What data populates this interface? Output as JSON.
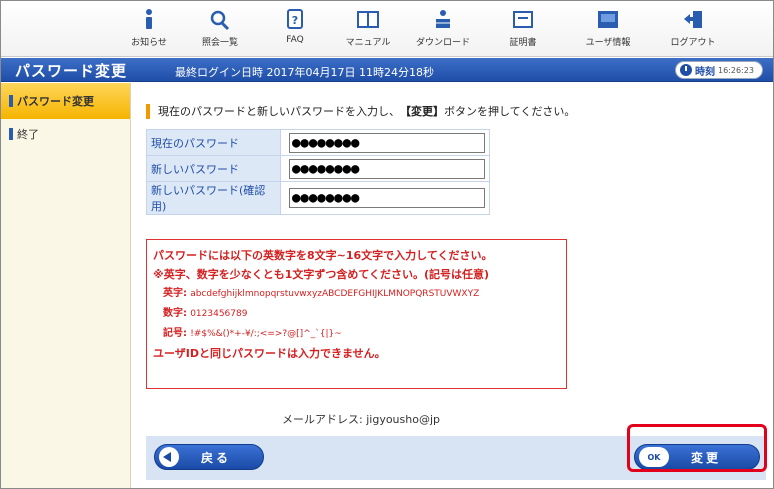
{
  "toolbar": {
    "items": [
      {
        "label": "お知らせ",
        "icon": "info-icon"
      },
      {
        "label": "照会一覧",
        "icon": "search-icon"
      },
      {
        "label": "FAQ",
        "icon": "faq-icon"
      },
      {
        "label": "マニュアル",
        "icon": "book-icon"
      },
      {
        "label": "ダウンロード",
        "icon": "download-icon"
      },
      {
        "label": "証明書",
        "icon": "certificate-icon"
      },
      {
        "label": "ユーザ情報",
        "icon": "user-info-icon"
      },
      {
        "label": "ログアウト",
        "icon": "logout-icon"
      }
    ]
  },
  "header": {
    "page_title": "パスワード変更",
    "last_login": "最終ログイン日時 2017年04月17日 11時24分18秒",
    "clock_label": "時刻",
    "clock_time": "16:26:23"
  },
  "sidebar": {
    "items": [
      {
        "label": "パスワード変更",
        "active": true
      },
      {
        "label": "終了",
        "active": false
      }
    ]
  },
  "main": {
    "instruction_pre": "現在のパスワードと新しいパスワードを入力し、",
    "instruction_key": "【変更】",
    "instruction_post": "ボタンを押してください。",
    "fields": [
      {
        "label": "現在のパスワード",
        "value": "●●●●●●●●"
      },
      {
        "label": "新しいパスワード",
        "value": "●●●●●●●●"
      },
      {
        "label": "新しいパスワード(確認用)",
        "value": "●●●●●●●●"
      }
    ],
    "rules": {
      "line1": "パスワードには以下の英数字を8文字~16文字で入力してください。",
      "line2": "※英字、数字を少なくとも1文字ずつ含めてください。(記号は任意)",
      "alpha_label": "英字:",
      "alpha_value": "abcdefghijklmnopqrstuvwxyzABCDEFGHIJKLMNOPQRSTUVWXYZ",
      "num_label": "数字:",
      "num_value": "0123456789",
      "sym_label": "記号:",
      "sym_value": "!#$%&()*+-¥/:;<=>?@[]^_`{|}~",
      "line_last": "ユーザIDと同じパスワードは入力できません。"
    },
    "email_label": "メールアドレス:",
    "email_value": "jigyousho@jp",
    "back_label": "戻る",
    "change_label": "変更",
    "change_icon_text": "OK"
  },
  "colors": {
    "accent_blue": "#1f4ea8",
    "rule_red": "#d42020",
    "highlight_red": "#e3001b",
    "active_yellow": "#f5b400"
  }
}
